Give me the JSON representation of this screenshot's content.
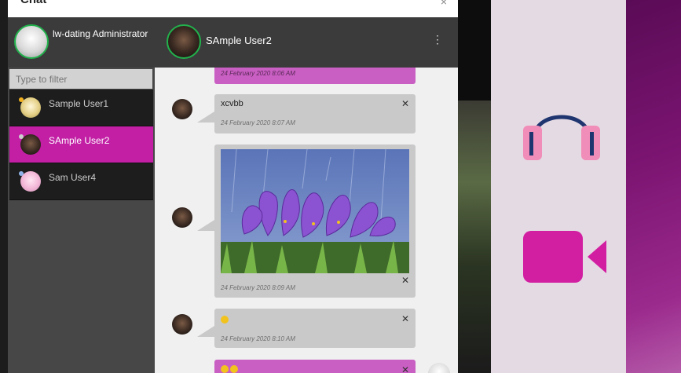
{
  "window": {
    "title": "Chat",
    "close_glyph": "×"
  },
  "header": {
    "me_name": "lw-dating Administrator",
    "peer_name": "SAmple User2",
    "menu_glyph": "⋮"
  },
  "sidebar": {
    "filter_placeholder": "Type to filter",
    "users": [
      {
        "name": "Sample User1",
        "status_color": "#f2b01e"
      },
      {
        "name": "SAmple User2",
        "status_color": "#cfcfcf"
      },
      {
        "name": "Sam User4",
        "status_color": "#8fb3e8"
      }
    ]
  },
  "messages": [
    {
      "time": "24 February 2020 8:06 AM",
      "text": ""
    },
    {
      "text": "xcvbb",
      "time": "24 February 2020 8:07 AM"
    },
    {
      "time": "24 February 2020 8:09 AM",
      "image": "purple crocus flowers photo"
    },
    {
      "time": "24 February 2020 8:10 AM",
      "emoji": "slightly-smiling-face"
    },
    {
      "emoji": "smiling-faces"
    }
  ],
  "colors": {
    "accent": "#c21fa5",
    "online": "#22b14c"
  },
  "icons": [
    "headset-icon",
    "video-camera-icon"
  ]
}
